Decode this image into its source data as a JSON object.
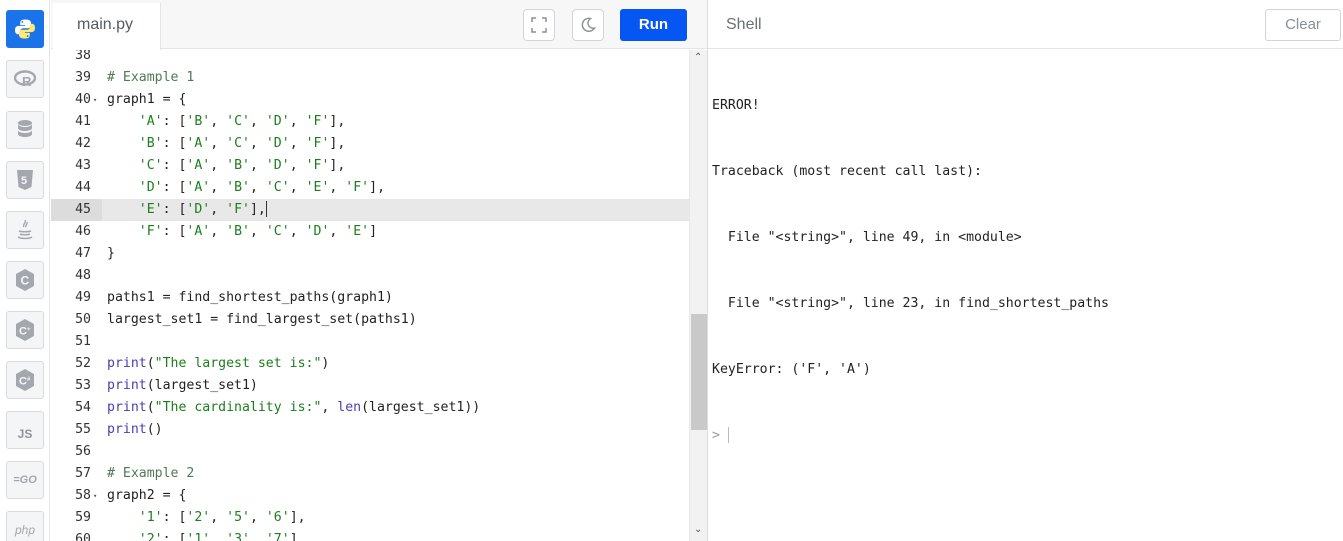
{
  "sidebar": {
    "languages": [
      {
        "name": "python",
        "icon": "python-icon",
        "active": true
      },
      {
        "name": "r",
        "icon": "r-icon",
        "label": "R"
      },
      {
        "name": "sql",
        "icon": "database-icon"
      },
      {
        "name": "html",
        "icon": "html5-icon",
        "label": "5"
      },
      {
        "name": "java",
        "icon": "java-icon"
      },
      {
        "name": "c",
        "icon": "c-icon",
        "label": "C"
      },
      {
        "name": "cpp",
        "icon": "cpp-icon",
        "label": "C++"
      },
      {
        "name": "csharp",
        "icon": "csharp-icon",
        "label": "C#"
      },
      {
        "name": "javascript",
        "icon": "js-icon",
        "label": "JS"
      },
      {
        "name": "go",
        "icon": "go-icon",
        "label": "=GO"
      },
      {
        "name": "php",
        "icon": "php-icon",
        "label": "php"
      }
    ]
  },
  "editor": {
    "tab_label": "main.py",
    "fullscreen_icon": "fullscreen-icon",
    "theme_icon": "moon-icon",
    "run_label": "Run",
    "lines": [
      {
        "n": "38",
        "tokens": []
      },
      {
        "n": "39",
        "tokens": [
          {
            "t": "# Example 1",
            "c": "comment"
          }
        ]
      },
      {
        "n": "40",
        "fold": true,
        "tokens": [
          {
            "t": "graph1 = {",
            "c": "plain"
          }
        ]
      },
      {
        "n": "41",
        "tokens": [
          {
            "t": "    ",
            "c": "plain"
          },
          {
            "t": "'A'",
            "c": "string"
          },
          {
            "t": ": [",
            "c": "plain"
          },
          {
            "t": "'B'",
            "c": "string"
          },
          {
            "t": ", ",
            "c": "plain"
          },
          {
            "t": "'C'",
            "c": "string"
          },
          {
            "t": ", ",
            "c": "plain"
          },
          {
            "t": "'D'",
            "c": "string"
          },
          {
            "t": ", ",
            "c": "plain"
          },
          {
            "t": "'F'",
            "c": "string"
          },
          {
            "t": "],",
            "c": "plain"
          }
        ]
      },
      {
        "n": "42",
        "tokens": [
          {
            "t": "    ",
            "c": "plain"
          },
          {
            "t": "'B'",
            "c": "string"
          },
          {
            "t": ": [",
            "c": "plain"
          },
          {
            "t": "'A'",
            "c": "string"
          },
          {
            "t": ", ",
            "c": "plain"
          },
          {
            "t": "'C'",
            "c": "string"
          },
          {
            "t": ", ",
            "c": "plain"
          },
          {
            "t": "'D'",
            "c": "string"
          },
          {
            "t": ", ",
            "c": "plain"
          },
          {
            "t": "'F'",
            "c": "string"
          },
          {
            "t": "],",
            "c": "plain"
          }
        ]
      },
      {
        "n": "43",
        "tokens": [
          {
            "t": "    ",
            "c": "plain"
          },
          {
            "t": "'C'",
            "c": "string"
          },
          {
            "t": ": [",
            "c": "plain"
          },
          {
            "t": "'A'",
            "c": "string"
          },
          {
            "t": ", ",
            "c": "plain"
          },
          {
            "t": "'B'",
            "c": "string"
          },
          {
            "t": ", ",
            "c": "plain"
          },
          {
            "t": "'D'",
            "c": "string"
          },
          {
            "t": ", ",
            "c": "plain"
          },
          {
            "t": "'F'",
            "c": "string"
          },
          {
            "t": "],",
            "c": "plain"
          }
        ]
      },
      {
        "n": "44",
        "tokens": [
          {
            "t": "    ",
            "c": "plain"
          },
          {
            "t": "'D'",
            "c": "string"
          },
          {
            "t": ": [",
            "c": "plain"
          },
          {
            "t": "'A'",
            "c": "string"
          },
          {
            "t": ", ",
            "c": "plain"
          },
          {
            "t": "'B'",
            "c": "string"
          },
          {
            "t": ", ",
            "c": "plain"
          },
          {
            "t": "'C'",
            "c": "string"
          },
          {
            "t": ", ",
            "c": "plain"
          },
          {
            "t": "'E'",
            "c": "string"
          },
          {
            "t": ", ",
            "c": "plain"
          },
          {
            "t": "'F'",
            "c": "string"
          },
          {
            "t": "],",
            "c": "plain"
          }
        ]
      },
      {
        "n": "45",
        "highlight": true,
        "cursor": true,
        "tokens": [
          {
            "t": "    ",
            "c": "plain"
          },
          {
            "t": "'E'",
            "c": "string"
          },
          {
            "t": ": [",
            "c": "plain"
          },
          {
            "t": "'D'",
            "c": "string"
          },
          {
            "t": ", ",
            "c": "plain"
          },
          {
            "t": "'F'",
            "c": "string"
          },
          {
            "t": "],",
            "c": "plain"
          }
        ]
      },
      {
        "n": "46",
        "tokens": [
          {
            "t": "    ",
            "c": "plain"
          },
          {
            "t": "'F'",
            "c": "string"
          },
          {
            "t": ": [",
            "c": "plain"
          },
          {
            "t": "'A'",
            "c": "string"
          },
          {
            "t": ", ",
            "c": "plain"
          },
          {
            "t": "'B'",
            "c": "string"
          },
          {
            "t": ", ",
            "c": "plain"
          },
          {
            "t": "'C'",
            "c": "string"
          },
          {
            "t": ", ",
            "c": "plain"
          },
          {
            "t": "'D'",
            "c": "string"
          },
          {
            "t": ", ",
            "c": "plain"
          },
          {
            "t": "'E'",
            "c": "string"
          },
          {
            "t": "]",
            "c": "plain"
          }
        ]
      },
      {
        "n": "47",
        "tokens": [
          {
            "t": "}",
            "c": "plain"
          }
        ]
      },
      {
        "n": "48",
        "tokens": []
      },
      {
        "n": "49",
        "tokens": [
          {
            "t": "paths1 = find_shortest_paths(graph1)",
            "c": "plain"
          }
        ]
      },
      {
        "n": "50",
        "tokens": [
          {
            "t": "largest_set1 = find_largest_set(paths1)",
            "c": "plain"
          }
        ]
      },
      {
        "n": "51",
        "tokens": []
      },
      {
        "n": "52",
        "tokens": [
          {
            "t": "print",
            "c": "builtin"
          },
          {
            "t": "(",
            "c": "plain"
          },
          {
            "t": "\"The largest set is:\"",
            "c": "string"
          },
          {
            "t": ")",
            "c": "plain"
          }
        ]
      },
      {
        "n": "53",
        "tokens": [
          {
            "t": "print",
            "c": "builtin"
          },
          {
            "t": "(largest_set1)",
            "c": "plain"
          }
        ]
      },
      {
        "n": "54",
        "tokens": [
          {
            "t": "print",
            "c": "builtin"
          },
          {
            "t": "(",
            "c": "plain"
          },
          {
            "t": "\"The cardinality is:\"",
            "c": "string"
          },
          {
            "t": ", ",
            "c": "plain"
          },
          {
            "t": "len",
            "c": "builtin"
          },
          {
            "t": "(largest_set1))",
            "c": "plain"
          }
        ]
      },
      {
        "n": "55",
        "tokens": [
          {
            "t": "print",
            "c": "builtin"
          },
          {
            "t": "()",
            "c": "plain"
          }
        ]
      },
      {
        "n": "56",
        "tokens": []
      },
      {
        "n": "57",
        "tokens": [
          {
            "t": "# Example 2",
            "c": "comment"
          }
        ]
      },
      {
        "n": "58",
        "fold": true,
        "tokens": [
          {
            "t": "graph2 = {",
            "c": "plain"
          }
        ]
      },
      {
        "n": "59",
        "tokens": [
          {
            "t": "    ",
            "c": "plain"
          },
          {
            "t": "'1'",
            "c": "string"
          },
          {
            "t": ": [",
            "c": "plain"
          },
          {
            "t": "'2'",
            "c": "string"
          },
          {
            "t": ", ",
            "c": "plain"
          },
          {
            "t": "'5'",
            "c": "string"
          },
          {
            "t": ", ",
            "c": "plain"
          },
          {
            "t": "'6'",
            "c": "string"
          },
          {
            "t": "],",
            "c": "plain"
          }
        ]
      },
      {
        "n": "60",
        "tokens": [
          {
            "t": "    ",
            "c": "plain"
          },
          {
            "t": "'2'",
            "c": "string"
          },
          {
            "t": ": [",
            "c": "plain"
          },
          {
            "t": "'1'",
            "c": "string"
          },
          {
            "t": ", ",
            "c": "plain"
          },
          {
            "t": "'3'",
            "c": "string"
          },
          {
            "t": ", ",
            "c": "plain"
          },
          {
            "t": "'7'",
            "c": "string"
          },
          {
            "t": "],",
            "c": "plain"
          }
        ]
      }
    ]
  },
  "shell": {
    "title": "Shell",
    "clear_label": "Clear",
    "output": [
      "ERROR!",
      "Traceback (most recent call last):",
      "  File \"<string>\", line 49, in <module>",
      "  File \"<string>\", line 23, in find_shortest_paths",
      "KeyError: ('F', 'A')"
    ],
    "prompt": ">"
  },
  "colors": {
    "accent": "#0556f3",
    "python_active": "#1a73e8",
    "string": "#1a7f1a",
    "comment": "#4f7a55",
    "builtin": "#4a3fb0"
  }
}
